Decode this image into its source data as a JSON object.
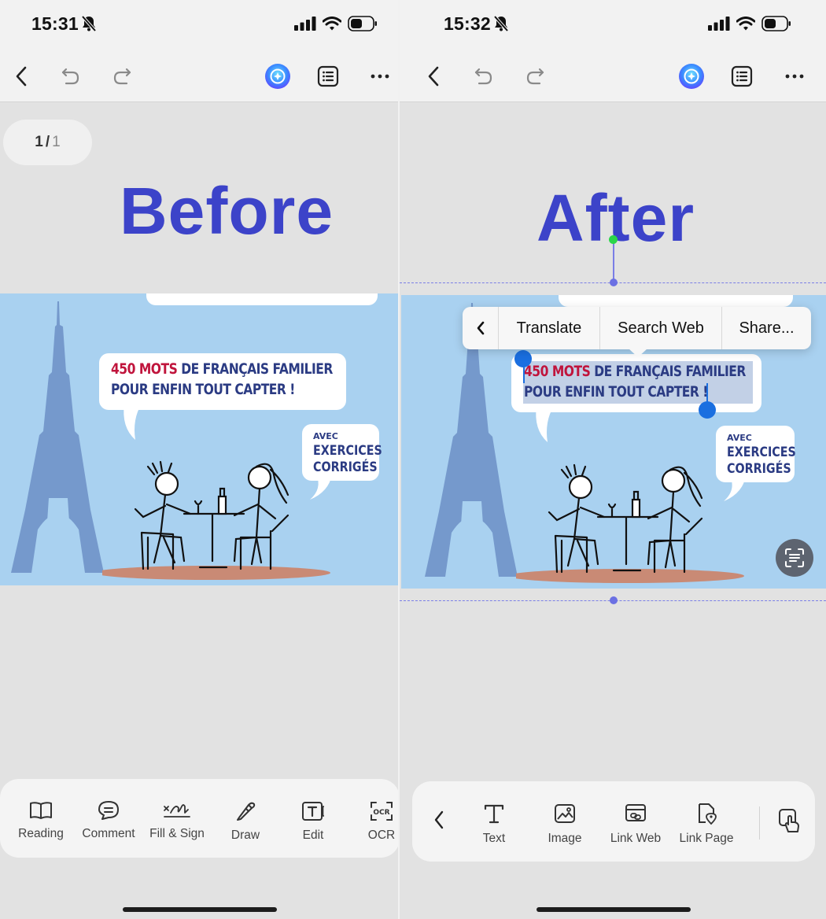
{
  "before": {
    "status": {
      "time": "15:31"
    },
    "page_indicator": {
      "current": "1",
      "separator": "/",
      "total": "1"
    },
    "label": "Before",
    "slide": {
      "headline_red": "450 MOTS",
      "headline_rest_line1": " DE FRANÇAIS FAMILIER",
      "headline_line2": "POUR ENFIN TOUT CAPTER !",
      "badge_small": "AVEC",
      "badge_line1": "EXERCICES",
      "badge_line2": "CORRIGÉS"
    },
    "bottom_tools": [
      {
        "label": "Reading",
        "icon": "book-icon"
      },
      {
        "label": "Comment",
        "icon": "comment-icon"
      },
      {
        "label": "Fill & Sign",
        "icon": "signature-icon"
      },
      {
        "label": "Draw",
        "icon": "pen-icon"
      },
      {
        "label": "Edit",
        "icon": "text-box-icon"
      },
      {
        "label": "OCR",
        "icon": "ocr-icon"
      }
    ]
  },
  "after": {
    "status": {
      "time": "15:32"
    },
    "label": "After",
    "context_menu": {
      "items": [
        "Translate",
        "Search Web",
        "Share..."
      ]
    },
    "slide": {
      "headline_red": "450 MOTS",
      "headline_rest_line1": " DE FRANÇAIS FAMILIER",
      "headline_line2": "POUR ENFIN TOUT CAPTER !",
      "badge_small": "AVEC",
      "badge_line1": "EXERCICES",
      "badge_line2": "CORRIGÉS"
    },
    "bottom_tools": [
      {
        "label": "Text",
        "icon": "text-icon"
      },
      {
        "label": "Image",
        "icon": "image-icon"
      },
      {
        "label": "Link Web",
        "icon": "link-web-icon"
      },
      {
        "label": "Link Page",
        "icon": "link-page-icon"
      }
    ]
  },
  "colors": {
    "title_blue": "#3c43c9",
    "slide_blue": "#a9d1f0",
    "headline_navy": "#2b3b83",
    "headline_red": "#c0143c",
    "selection_blue": "#1a6fe0"
  }
}
